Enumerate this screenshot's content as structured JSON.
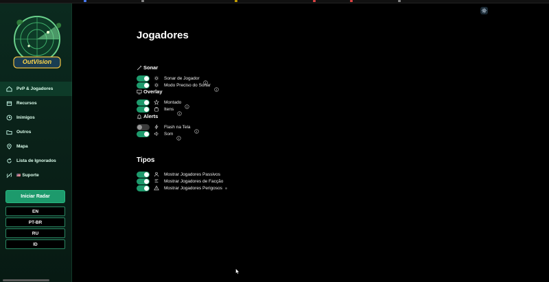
{
  "app": {
    "logo_text": "OutVision"
  },
  "sidebar": {
    "items": [
      {
        "label": "PvP & Jogadores",
        "icon": "home-icon",
        "active": true
      },
      {
        "label": "Recursos",
        "icon": "box-icon",
        "active": false
      },
      {
        "label": "Inimigos",
        "icon": "clock-icon",
        "active": false
      },
      {
        "label": "Outros",
        "icon": "folder-icon",
        "active": false
      },
      {
        "label": "Mapa",
        "icon": "map-pin-icon",
        "active": false
      },
      {
        "label": "Lista de Ignorados",
        "icon": "refresh-icon",
        "active": false
      },
      {
        "label": "Suporte",
        "icon": "broadcast-icon",
        "flag": "🇺🇸",
        "active": false
      }
    ],
    "start_button": "Iniciar Radar",
    "languages": [
      "EN",
      "PT-BR",
      "RU",
      "ID"
    ]
  },
  "page": {
    "title": "Jogadores",
    "sections": [
      {
        "title": "Sonar",
        "icon": "pencil-icon",
        "rows": [
          {
            "label": "Sonar de Jogador",
            "icon": "sun-icon",
            "on": true
          },
          {
            "label": "Modo Preciso do Sonar",
            "icon": "sun-icon",
            "on": true
          }
        ]
      },
      {
        "title": "Overlay",
        "icon": "monitor-icon",
        "rows": [
          {
            "label": "Montado",
            "icon": "star-icon",
            "on": true
          },
          {
            "label": "Itens",
            "icon": "bag-icon",
            "on": true
          }
        ]
      },
      {
        "title": "Alerts",
        "icon": "bell-icon",
        "rows": [
          {
            "label": "Flash na Tela",
            "icon": "bolt-icon",
            "on": false
          },
          {
            "label": "Som",
            "icon": "speaker-icon",
            "on": true
          }
        ]
      }
    ],
    "types": {
      "title": "Tipos",
      "rows": [
        {
          "label": "Mostrar Jogadores Passivos",
          "icon": "user-icon",
          "on": true
        },
        {
          "label": "Mostrar Jogadores de Facção",
          "icon": "flag-icon",
          "on": true
        },
        {
          "label": "Mostrar Jogadores Perigosos",
          "icon": "warning-icon",
          "on": true
        }
      ]
    }
  },
  "colors": {
    "accent": "#1d9a6c",
    "sidebar_bg": "#0a2219",
    "page_bg": "#000000"
  }
}
